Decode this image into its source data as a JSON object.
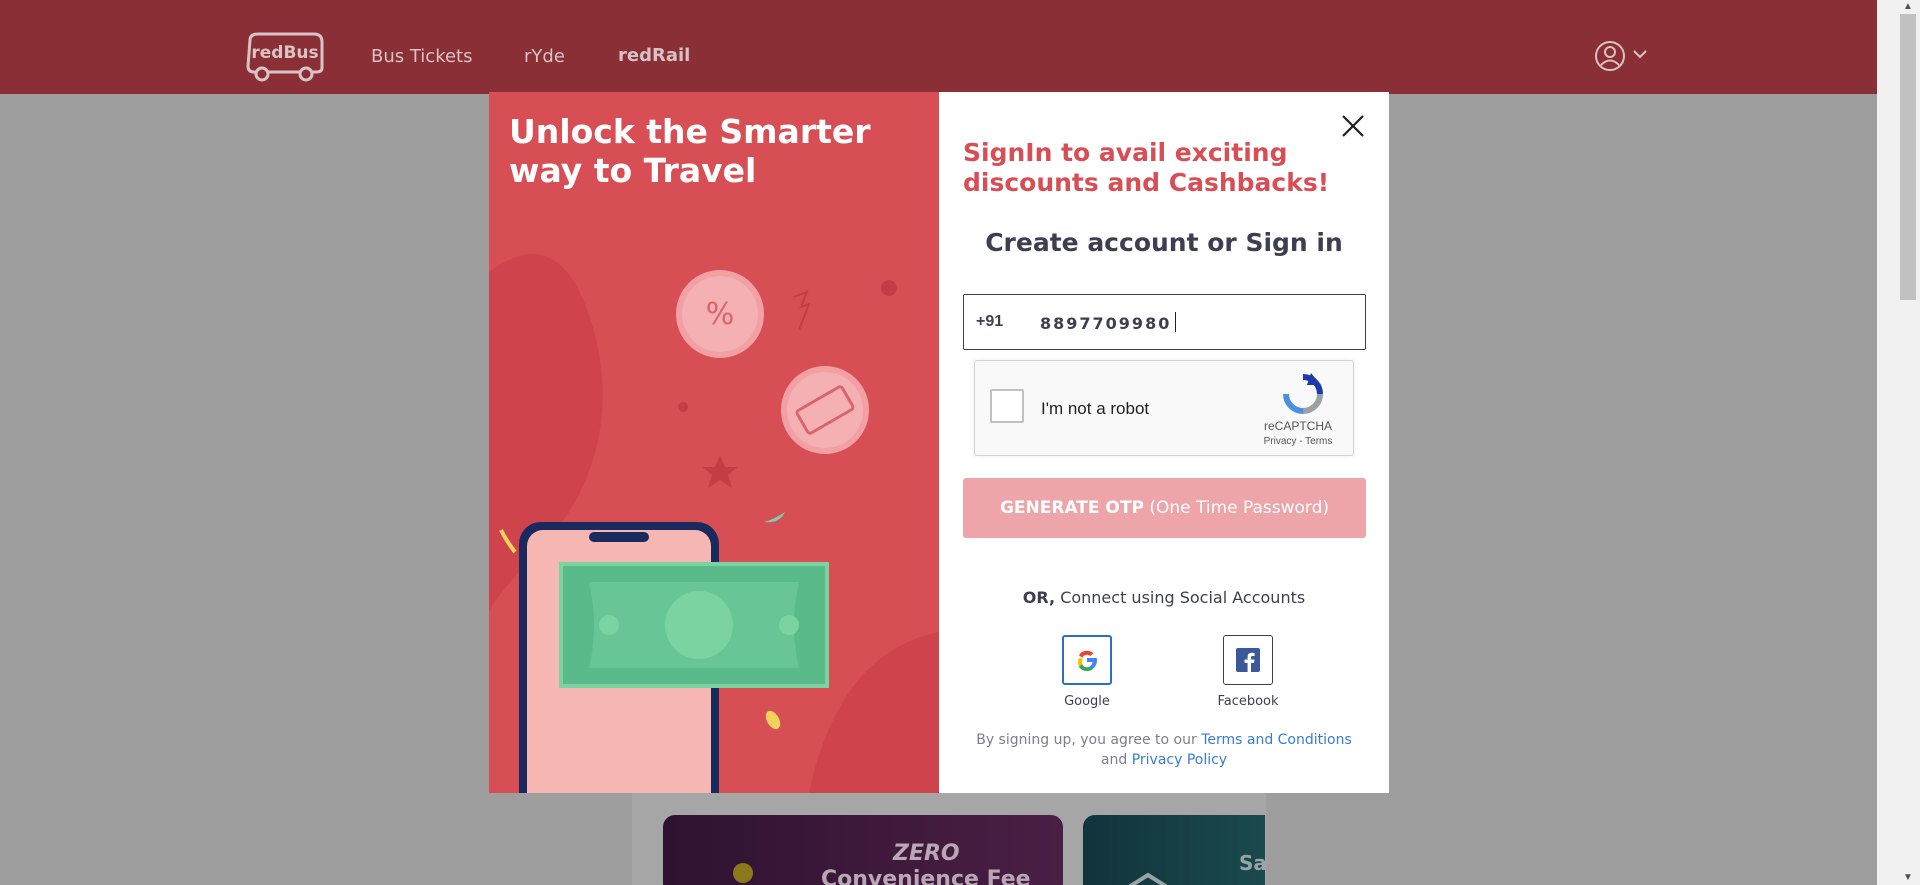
{
  "header": {
    "logo_text": "redBus",
    "nav": [
      {
        "label": "Bus Tickets"
      },
      {
        "label": "rYde"
      },
      {
        "label": "redRail"
      }
    ]
  },
  "background": {
    "promo1_zero": "ZERO",
    "promo1_text": "Convenience Fee",
    "promo2_text": "Sav"
  },
  "modal": {
    "left_title": "Unlock the Smarter way to Travel",
    "promo_heading": "SignIn to avail exciting discounts and Cashbacks!",
    "create_heading": "Create account or Sign in",
    "phone": {
      "country_code": "+91",
      "value": "8897709980"
    },
    "recaptcha": {
      "label": "I'm not a robot",
      "brand": "reCAPTCHA",
      "links": "Privacy - Terms"
    },
    "otp_button": {
      "bold": "GENERATE OTP",
      "rest": "(One Time Password)"
    },
    "or_text": {
      "bold": "OR,",
      "rest": "Connect using Social Accounts"
    },
    "social": {
      "google_label": "Google",
      "facebook_label": "Facebook"
    },
    "terms": {
      "prefix": "By signing up, you agree to our",
      "terms_link": "Terms and Conditions",
      "and": "and",
      "privacy_link": "Privacy Policy"
    }
  },
  "colors": {
    "header_bg": "#8b2f36",
    "brand_red": "#d84e55",
    "otp_disabled": "#eea5a9",
    "link_blue": "#3a7bd5"
  }
}
